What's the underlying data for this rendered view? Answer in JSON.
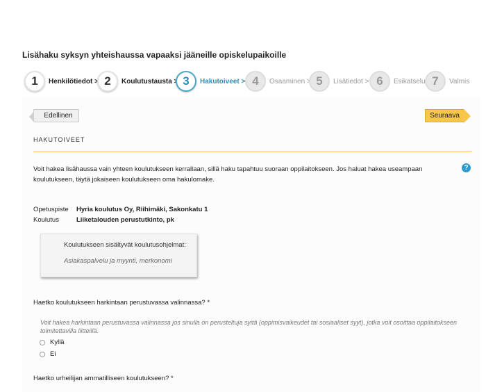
{
  "page": {
    "title": "Lisähaku syksyn yhteishaussa vapaaksi jääneille opiskelupaikoille"
  },
  "steps": [
    {
      "number": "1",
      "label": "Henkilötiedot >",
      "state": "done"
    },
    {
      "number": "2",
      "label": "Koulutustausta >",
      "state": "done"
    },
    {
      "number": "3",
      "label": "Hakutoiveet >",
      "state": "active"
    },
    {
      "number": "4",
      "label": "Osaaminen >",
      "state": "future"
    },
    {
      "number": "5",
      "label": "Lisätiedot >",
      "state": "future"
    },
    {
      "number": "6",
      "label": "Esikatselu",
      "state": "future"
    },
    {
      "number": "7",
      "label": "Valmis",
      "state": "future"
    }
  ],
  "nav": {
    "prev_label": "Edellinen",
    "next_label": "Seuraava"
  },
  "section": {
    "title": "HAKUTOIVEET",
    "intro": "Voit hakea lisähaussa vain yhteen koulutukseen kerrallaan, sillä haku tapahtuu suoraan oppilaitokseen. Jos haluat hakea useampaan koulutukseen, täytä jokaiseen koulutukseen oma hakulomake.",
    "help_icon": "?"
  },
  "application": {
    "school_label": "Opetuspiste",
    "school_value": "Hyria koulutus Oy, Riihimäki, Sakonkatu 1",
    "program_label": "Koulutus",
    "program_value": "Liiketalouden perustutkinto, pk"
  },
  "programs_box": {
    "title": "Koulutukseen sisältyvät koulutusohjelmat:",
    "item": "Asiakaspalvelu ja myynti, merkonomi"
  },
  "question1": {
    "text": "Haetko koulutukseen harkintaan perustuvassa valinnassa? *",
    "hint": "Voit hakea harkintaan perustuvassa valinnassa jos sinulla on perusteltuja syitä (oppimisvaikeudet tai sosiaaliset syyt), jotka voit osoittaa oppilaitokseen toimitettavilla liitteillä.",
    "option_yes": "Kyllä",
    "option_no": "Ei"
  },
  "question2": {
    "text": "Haetko urheilijan ammatilliseen koulutukseen? *"
  },
  "colors": {
    "accent": "#2e8db8",
    "next_button": "#f8c64a",
    "divider": "#f0c96a"
  }
}
